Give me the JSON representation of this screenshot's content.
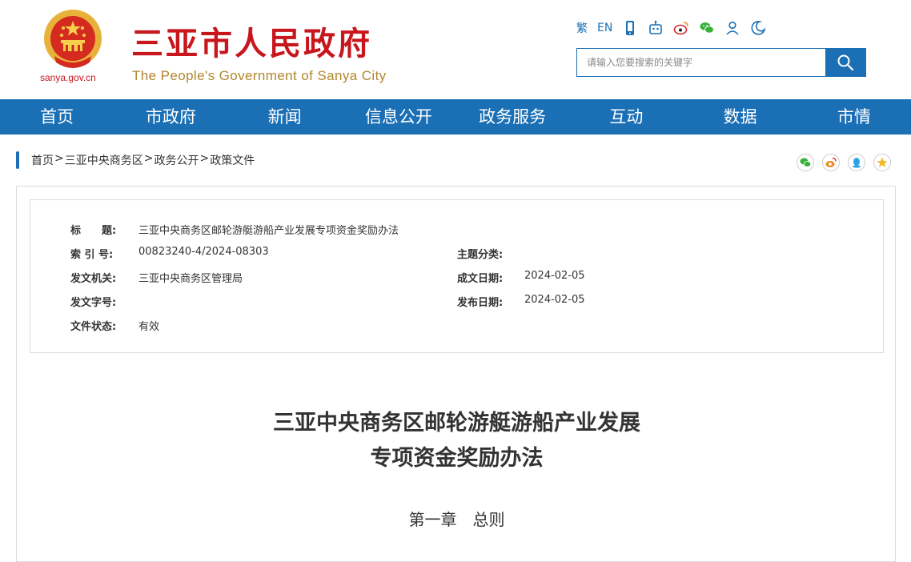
{
  "header": {
    "title_cn": "三亚市人民政府",
    "title_en": "The People's Government of Sanya City",
    "domain": "sanya.gov.cn",
    "brand_red": "#c8161d",
    "brand_gold": "#b2862e"
  },
  "tools": {
    "traditional": "繁",
    "english": "EN",
    "icons": [
      "mobile-icon",
      "robot-icon",
      "weibo-icon",
      "wechat-icon",
      "user-icon",
      "elder-mode-icon"
    ]
  },
  "search": {
    "placeholder": "请输入您要搜索的关键字",
    "value": ""
  },
  "nav": {
    "items": [
      "首页",
      "市政府",
      "新闻",
      "信息公开",
      "政务服务",
      "互动",
      "数据",
      "市情"
    ],
    "color": "#1a6fb5"
  },
  "breadcrumb": {
    "items": [
      "首页",
      "三亚中央商务区",
      "政务公开",
      "政策文件"
    ],
    "separator": ">"
  },
  "share": {
    "icons": [
      "wechat-icon",
      "weibo-icon",
      "qq-icon",
      "star-icon"
    ]
  },
  "meta": {
    "title_label": "标　　题:",
    "title_value": "三亚中央商务区邮轮游艇游船产业发展专项资金奖励办法",
    "index_label": "索 引 号:",
    "index_value": "00823240-4/2024-08303",
    "topic_label": "主题分类:",
    "topic_value": "",
    "issuer_label": "发文机关:",
    "issuer_value": "三亚中央商务区管理局",
    "written_label": "成文日期:",
    "written_value": "2024-02-05",
    "docno_label": "发文字号:",
    "docno_value": "",
    "published_label": "发布日期:",
    "published_value": "2024-02-05",
    "status_label": "文件状态:",
    "status_value": "有效"
  },
  "document": {
    "title_line1": "三亚中央商务区邮轮游艇游船产业发展",
    "title_line2": "专项资金奖励办法",
    "chapter": "第一章　总则"
  }
}
